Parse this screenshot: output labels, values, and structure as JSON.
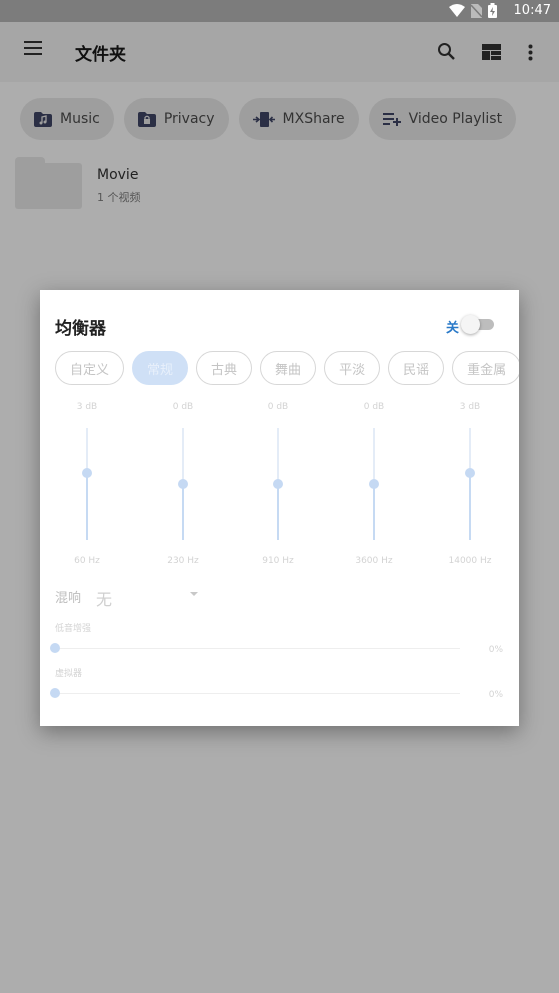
{
  "status_bar": {
    "time": "10:47",
    "icons": [
      "wifi-icon",
      "no-sim-icon",
      "battery-charging-icon"
    ]
  },
  "toolbar": {
    "title": "文件夹",
    "icons": [
      "menu-icon",
      "search-icon",
      "view-layout-icon",
      "more-vert-icon"
    ]
  },
  "chips": [
    {
      "label": "Music",
      "icon": "music-folder-icon"
    },
    {
      "label": "Privacy",
      "icon": "lock-folder-icon"
    },
    {
      "label": "MXShare",
      "icon": "share-icon"
    },
    {
      "label": "Video Playlist",
      "icon": "playlist-add-icon"
    }
  ],
  "folders": [
    {
      "name": "Movie",
      "meta": "1 个视频"
    }
  ],
  "equalizer": {
    "title": "均衡器",
    "switch_label": "关",
    "enabled": false,
    "presets": [
      "自定义",
      "常规",
      "古典",
      "舞曲",
      "平淡",
      "民谣",
      "重金属"
    ],
    "active_preset": "常规",
    "bands": [
      {
        "freq": "60 Hz",
        "gain": "3 dB",
        "level": 0.6
      },
      {
        "freq": "230 Hz",
        "gain": "0 dB",
        "level": 0.5
      },
      {
        "freq": "910 Hz",
        "gain": "0 dB",
        "level": 0.5
      },
      {
        "freq": "3600 Hz",
        "gain": "0 dB",
        "level": 0.5
      },
      {
        "freq": "14000 Hz",
        "gain": "3 dB",
        "level": 0.6
      }
    ],
    "reverb": {
      "label": "混响",
      "value": "无"
    },
    "sliders": [
      {
        "label": "低音增强",
        "value": "0%",
        "level": 0
      },
      {
        "label": "虚拟器",
        "value": "0%",
        "level": 0
      }
    ]
  },
  "colors": {
    "accent": "#2979c8",
    "dim_overlay": "#adadad",
    "slider_blue": "#c5d9f3"
  }
}
